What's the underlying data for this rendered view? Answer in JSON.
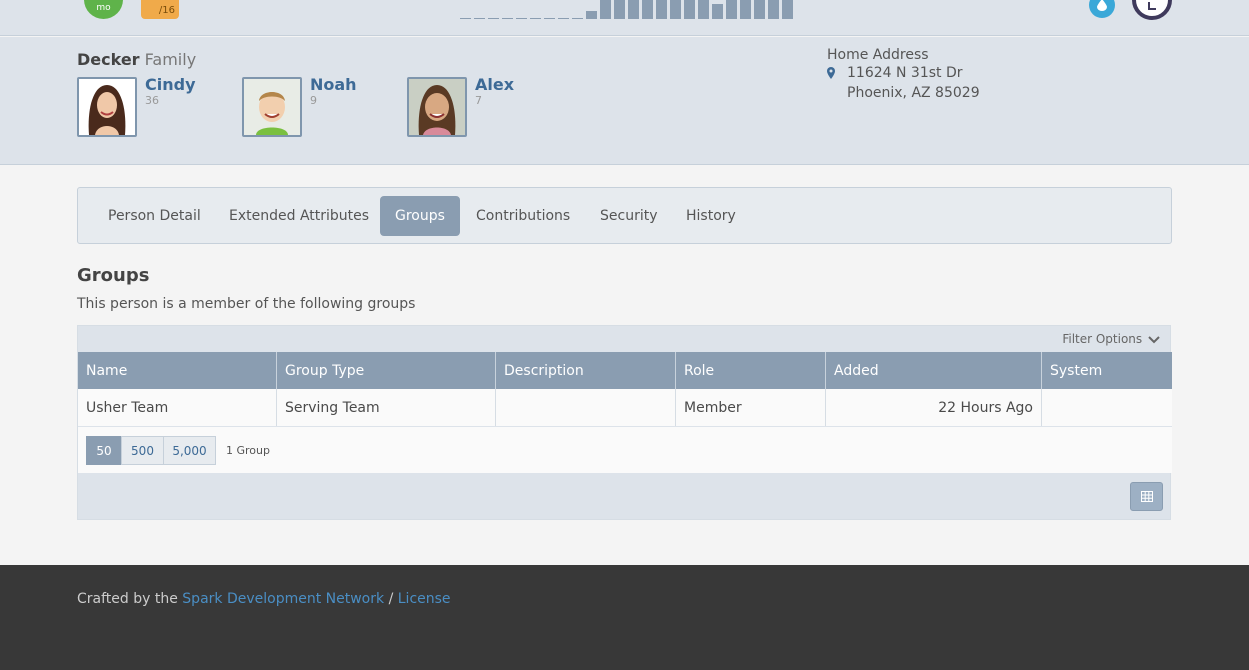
{
  "top_badges": {
    "green_text": "mo",
    "orange_text": "/16"
  },
  "attendance_bars": [
    0.05,
    0.05,
    0.05,
    0.05,
    0.05,
    0.05,
    0.05,
    0.05,
    0.05,
    0.4,
    1,
    1,
    1,
    1,
    1,
    1,
    1,
    1,
    0.8,
    1,
    1,
    1,
    1,
    1
  ],
  "family": {
    "last_name": "Decker",
    "suffix": "Family",
    "members": [
      {
        "name": "Cindy",
        "age": "36"
      },
      {
        "name": "Noah",
        "age": "9"
      },
      {
        "name": "Alex",
        "age": "7"
      }
    ]
  },
  "address": {
    "label": "Home Address",
    "line1": "11624 N 31st Dr",
    "line2": "Phoenix, AZ 85029"
  },
  "tabs": [
    "Person Detail",
    "Extended Attributes",
    "Groups",
    "Contributions",
    "Security",
    "History"
  ],
  "active_tab": "Groups",
  "section": {
    "title": "Groups",
    "description": "This person is a member of the following groups"
  },
  "grid": {
    "filter_label": "Filter Options",
    "columns": [
      "Name",
      "Group Type",
      "Description",
      "Role",
      "Added",
      "System"
    ],
    "rows": [
      {
        "name": "Usher Team",
        "group_type": "Serving Team",
        "description": "",
        "role": "Member",
        "added": "22 Hours Ago",
        "system": ""
      }
    ],
    "page_sizes": [
      "50",
      "500",
      "5,000"
    ],
    "active_page_size": "50",
    "count": "1 Group"
  },
  "footer": {
    "prefix": "Crafted by the",
    "link1": "Spark Development Network",
    "separator": "/",
    "link2": "License"
  },
  "colors": {
    "accent": "#8a9db1",
    "link": "#3d6a96",
    "footer_bg": "#383838",
    "footer_link": "#4a8ec4"
  }
}
